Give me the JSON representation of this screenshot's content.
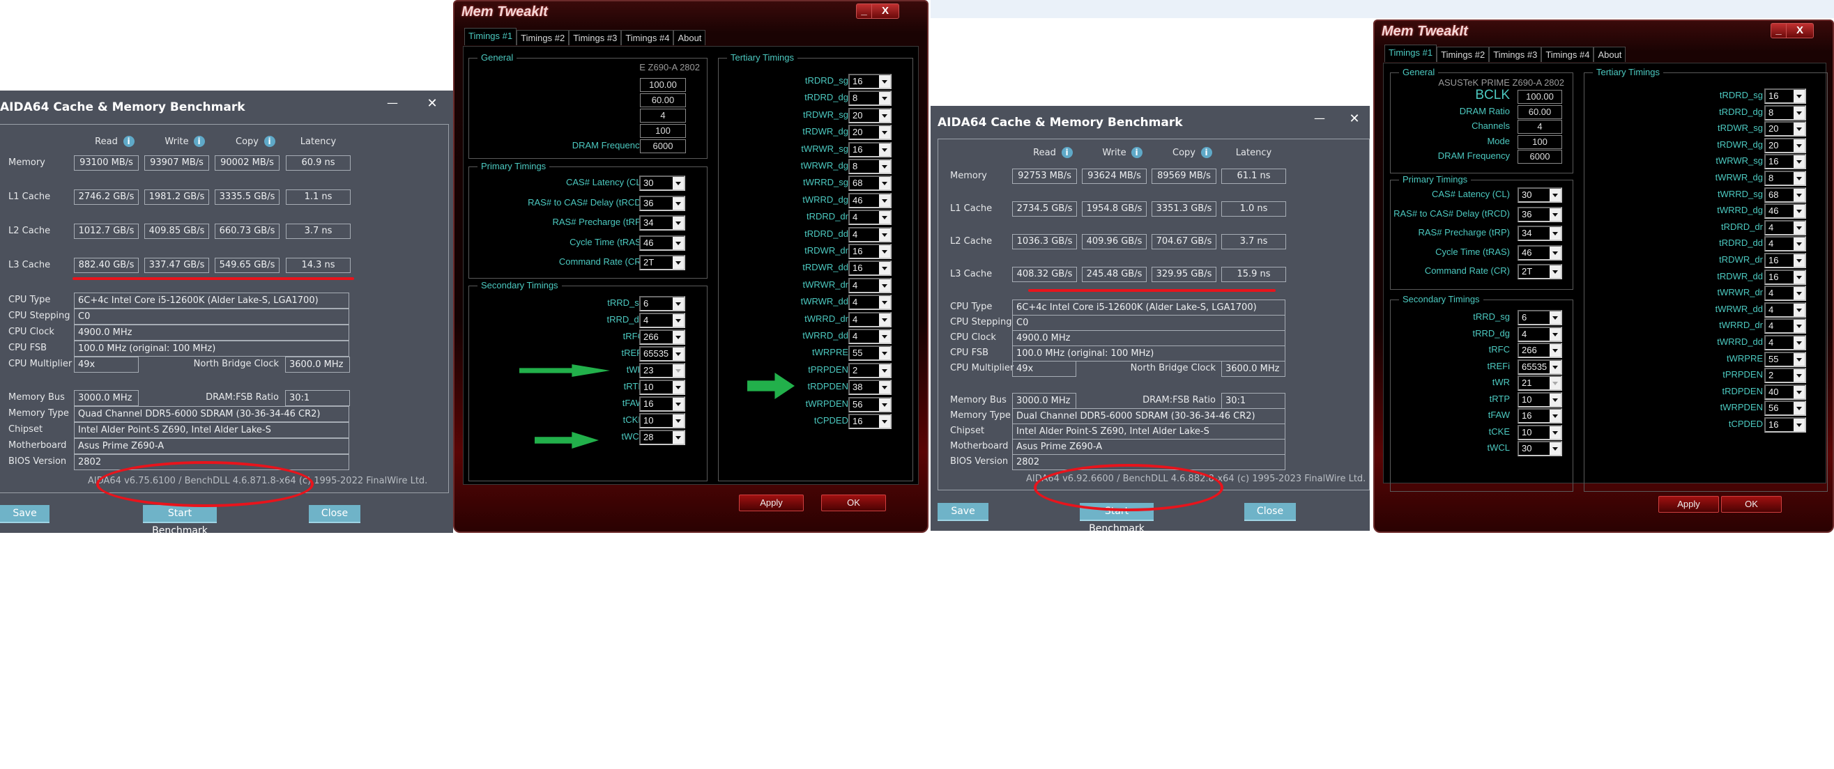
{
  "aida_left": {
    "title": "AIDA64 Cache & Memory Benchmark",
    "minimize_glyph": "—",
    "close_glyph": "✕",
    "columns": [
      "Read",
      "Write",
      "Copy",
      "Latency"
    ],
    "info_glyph": "i",
    "rows": [
      {
        "label": "Memory",
        "read": "93100 MB/s",
        "write": "93907 MB/s",
        "copy": "90002 MB/s",
        "latency": "60.9 ns"
      },
      {
        "label": "L1 Cache",
        "read": "2746.2 GB/s",
        "write": "1981.2 GB/s",
        "copy": "3335.5 GB/s",
        "latency": "1.1 ns"
      },
      {
        "label": "L2 Cache",
        "read": "1012.7 GB/s",
        "write": "409.85 GB/s",
        "copy": "660.73 GB/s",
        "latency": "3.7 ns"
      },
      {
        "label": "L3 Cache",
        "read": "882.40 GB/s",
        "write": "337.47 GB/s",
        "copy": "549.65 GB/s",
        "latency": "14.3 ns"
      }
    ],
    "info": {
      "cpu_type_label": "CPU Type",
      "cpu_type": "6C+4c Intel Core i5-12600K  (Alder Lake-S, LGA1700)",
      "cpu_stepping_label": "CPU Stepping",
      "cpu_stepping": "C0",
      "cpu_clock_label": "CPU Clock",
      "cpu_clock": "4900.0 MHz",
      "cpu_fsb_label": "CPU FSB",
      "cpu_fsb": "100.0 MHz  (original: 100 MHz)",
      "cpu_mult_label": "CPU Multiplier",
      "cpu_mult": "49x",
      "nb_clock_label": "North Bridge Clock",
      "nb_clock": "3600.0 MHz",
      "mem_bus_label": "Memory Bus",
      "mem_bus": "3000.0 MHz",
      "dram_fsb_label": "DRAM:FSB Ratio",
      "dram_fsb": "30:1",
      "mem_type_label": "Memory Type",
      "mem_type": "Quad Channel DDR5-6000 SDRAM  (30-36-34-46 CR2)",
      "chipset_label": "Chipset",
      "chipset": "Intel Alder Point-S Z690, Intel Alder Lake-S",
      "mobo_label": "Motherboard",
      "mobo": "Asus Prime Z690-A",
      "bios_label": "BIOS Version",
      "bios": "2802"
    },
    "footer": "AIDA64 v6.75.6100 / BenchDLL 4.6.871.8-x64  (c) 1995-2022 FinalWire Ltd.",
    "buttons": {
      "save": "Save",
      "start": "Start Benchmark",
      "close": "Close"
    }
  },
  "aida_right": {
    "title": "AIDA64 Cache & Memory Benchmark",
    "minimize_glyph": "—",
    "close_glyph": "✕",
    "columns": [
      "Read",
      "Write",
      "Copy",
      "Latency"
    ],
    "info_glyph": "i",
    "rows": [
      {
        "label": "Memory",
        "read": "92753 MB/s",
        "write": "93624 MB/s",
        "copy": "89569 MB/s",
        "latency": "61.1 ns"
      },
      {
        "label": "L1 Cache",
        "read": "2734.5 GB/s",
        "write": "1954.8 GB/s",
        "copy": "3351.3 GB/s",
        "latency": "1.0 ns"
      },
      {
        "label": "L2 Cache",
        "read": "1036.3 GB/s",
        "write": "409.96 GB/s",
        "copy": "704.67 GB/s",
        "latency": "3.7 ns"
      },
      {
        "label": "L3 Cache",
        "read": "408.32 GB/s",
        "write": "245.48 GB/s",
        "copy": "329.95 GB/s",
        "latency": "15.9 ns"
      }
    ],
    "info": {
      "cpu_type_label": "CPU Type",
      "cpu_type": "6C+4c Intel Core i5-12600K  (Alder Lake-S, LGA1700)",
      "cpu_stepping_label": "CPU Stepping",
      "cpu_stepping": "C0",
      "cpu_clock_label": "CPU Clock",
      "cpu_clock": "4900.0 MHz",
      "cpu_fsb_label": "CPU FSB",
      "cpu_fsb": "100.0 MHz  (original: 100 MHz)",
      "cpu_mult_label": "CPU Multiplier",
      "cpu_mult": "49x",
      "nb_clock_label": "North Bridge Clock",
      "nb_clock": "3600.0 MHz",
      "mem_bus_label": "Memory Bus",
      "mem_bus": "3000.0 MHz",
      "dram_fsb_label": "DRAM:FSB Ratio",
      "dram_fsb": "30:1",
      "mem_type_label": "Memory Type",
      "mem_type": "Dual Channel DDR5-6000 SDRAM  (30-36-34-46 CR2)",
      "chipset_label": "Chipset",
      "chipset": "Intel Alder Point-S Z690, Intel Alder Lake-S",
      "mobo_label": "Motherboard",
      "mobo": "Asus Prime Z690-A",
      "bios_label": "BIOS Version",
      "bios": "2802"
    },
    "footer": "AIDA64 v6.92.6600 / BenchDLL 4.6.882.8-x64  (c) 1995-2023 FinalWire Ltd.",
    "buttons": {
      "save": "Save",
      "start": "Start Benchmark",
      "close": "Close"
    }
  },
  "mti_left": {
    "title": "Mem TweakIt",
    "min_glyph": "_",
    "close_glyph": "X",
    "tabs": [
      "Timings #1",
      "Timings #2",
      "Timings #3",
      "Timings #4",
      "About"
    ],
    "general_label": "General",
    "board": "E Z690-A 2802",
    "general": [
      {
        "label": "",
        "value": "100.00"
      },
      {
        "label": "",
        "value": "60.00"
      },
      {
        "label": "",
        "value": "4"
      },
      {
        "label": "",
        "value": "100"
      },
      {
        "label": "DRAM Frequency",
        "value": "6000"
      }
    ],
    "primary_label": "Primary Timings",
    "primary": [
      {
        "label": "CAS# Latency (CL)",
        "value": "30"
      },
      {
        "label": "RAS# to CAS# Delay (tRCD)",
        "value": "36"
      },
      {
        "label": "RAS# Precharge (tRP)",
        "value": "34"
      },
      {
        "label": "Cycle Time (tRAS)",
        "value": "46"
      },
      {
        "label": "Command Rate (CR)",
        "value": "2T"
      }
    ],
    "secondary_label": "Secondary Timings",
    "secondary": [
      {
        "label": "tRRD_sg",
        "value": "6"
      },
      {
        "label": "tRRD_dg",
        "value": "4"
      },
      {
        "label": "tRFC",
        "value": "266"
      },
      {
        "label": "tREFi",
        "value": "65535"
      },
      {
        "label": "tWR",
        "value": "23"
      },
      {
        "label": "tRTP",
        "value": "10"
      },
      {
        "label": "tFAW",
        "value": "16"
      },
      {
        "label": "tCKE",
        "value": "10"
      },
      {
        "label": "tWCL",
        "value": "28"
      }
    ],
    "tertiary_label": "Tertiary Timings",
    "tertiary": [
      {
        "label": "tRDRD_sg",
        "value": "16"
      },
      {
        "label": "tRDRD_dg",
        "value": "8"
      },
      {
        "label": "tRDWR_sg",
        "value": "20"
      },
      {
        "label": "tRDWR_dg",
        "value": "20"
      },
      {
        "label": "tWRWR_sg",
        "value": "16"
      },
      {
        "label": "tWRWR_dg",
        "value": "8"
      },
      {
        "label": "tWRRD_sg",
        "value": "68"
      },
      {
        "label": "tWRRD_dg",
        "value": "46"
      },
      {
        "label": "tRDRD_dr",
        "value": "4"
      },
      {
        "label": "tRDRD_dd",
        "value": "4"
      },
      {
        "label": "tRDWR_dr",
        "value": "16"
      },
      {
        "label": "tRDWR_dd",
        "value": "16"
      },
      {
        "label": "tWRWR_dr",
        "value": "4"
      },
      {
        "label": "tWRWR_dd",
        "value": "4"
      },
      {
        "label": "tWRRD_dr",
        "value": "4"
      },
      {
        "label": "tWRRD_dd",
        "value": "4"
      },
      {
        "label": "tWRPRE",
        "value": "55"
      },
      {
        "label": "tPRPDEN",
        "value": "2"
      },
      {
        "label": "tRDPDEN",
        "value": "38"
      },
      {
        "label": "tWRPDEN",
        "value": "56"
      },
      {
        "label": "tCPDED",
        "value": "16"
      }
    ],
    "buttons": {
      "apply": "Apply",
      "ok": "OK"
    }
  },
  "mti_right": {
    "title": "Mem TweakIt",
    "min_glyph": "_",
    "close_glyph": "X",
    "tabs": [
      "Timings #1",
      "Timings #2",
      "Timings #3",
      "Timings #4",
      "About"
    ],
    "general_label": "General",
    "board": "ASUSTeK PRIME Z690-A 2802",
    "general": [
      {
        "label": "BCLK",
        "value": "100.00"
      },
      {
        "label": "DRAM Ratio",
        "value": "60.00"
      },
      {
        "label": "Channels",
        "value": "4"
      },
      {
        "label": "Mode",
        "value": "100"
      },
      {
        "label": "DRAM Frequency",
        "value": "6000"
      }
    ],
    "primary_label": "Primary Timings",
    "primary": [
      {
        "label": "CAS# Latency (CL)",
        "value": "30"
      },
      {
        "label": "RAS# to CAS# Delay (tRCD)",
        "value": "36"
      },
      {
        "label": "RAS# Precharge (tRP)",
        "value": "34"
      },
      {
        "label": "Cycle Time (tRAS)",
        "value": "46"
      },
      {
        "label": "Command Rate (CR)",
        "value": "2T"
      }
    ],
    "secondary_label": "Secondary Timings",
    "secondary": [
      {
        "label": "tRRD_sg",
        "value": "6"
      },
      {
        "label": "tRRD_dg",
        "value": "4"
      },
      {
        "label": "tRFC",
        "value": "266"
      },
      {
        "label": "tREFi",
        "value": "65535"
      },
      {
        "label": "tWR",
        "value": "21"
      },
      {
        "label": "tRTP",
        "value": "10"
      },
      {
        "label": "tFAW",
        "value": "16"
      },
      {
        "label": "tCKE",
        "value": "10"
      },
      {
        "label": "tWCL",
        "value": "30"
      }
    ],
    "tertiary_label": "Tertiary Timings",
    "tertiary": [
      {
        "label": "tRDRD_sg",
        "value": "16"
      },
      {
        "label": "tRDRD_dg",
        "value": "8"
      },
      {
        "label": "tRDWR_sg",
        "value": "20"
      },
      {
        "label": "tRDWR_dg",
        "value": "20"
      },
      {
        "label": "tWRWR_sg",
        "value": "16"
      },
      {
        "label": "tWRWR_dg",
        "value": "8"
      },
      {
        "label": "tWRRD_sg",
        "value": "68"
      },
      {
        "label": "tWRRD_dg",
        "value": "46"
      },
      {
        "label": "tRDRD_dr",
        "value": "4"
      },
      {
        "label": "tRDRD_dd",
        "value": "4"
      },
      {
        "label": "tRDWR_dr",
        "value": "16"
      },
      {
        "label": "tRDWR_dd",
        "value": "16"
      },
      {
        "label": "tWRWR_dr",
        "value": "4"
      },
      {
        "label": "tWRWR_dd",
        "value": "4"
      },
      {
        "label": "tWRRD_dr",
        "value": "4"
      },
      {
        "label": "tWRRD_dd",
        "value": "4"
      },
      {
        "label": "tWRPRE",
        "value": "55"
      },
      {
        "label": "tPRPDEN",
        "value": "2"
      },
      {
        "label": "tRDPDEN",
        "value": "40"
      },
      {
        "label": "tWRPDEN",
        "value": "56"
      },
      {
        "label": "tCPDED",
        "value": "16"
      }
    ],
    "buttons": {
      "apply": "Apply",
      "ok": "OK"
    }
  },
  "annotations": {
    "arrow_color": "#22b04b",
    "mark_color": "#e8141c"
  }
}
